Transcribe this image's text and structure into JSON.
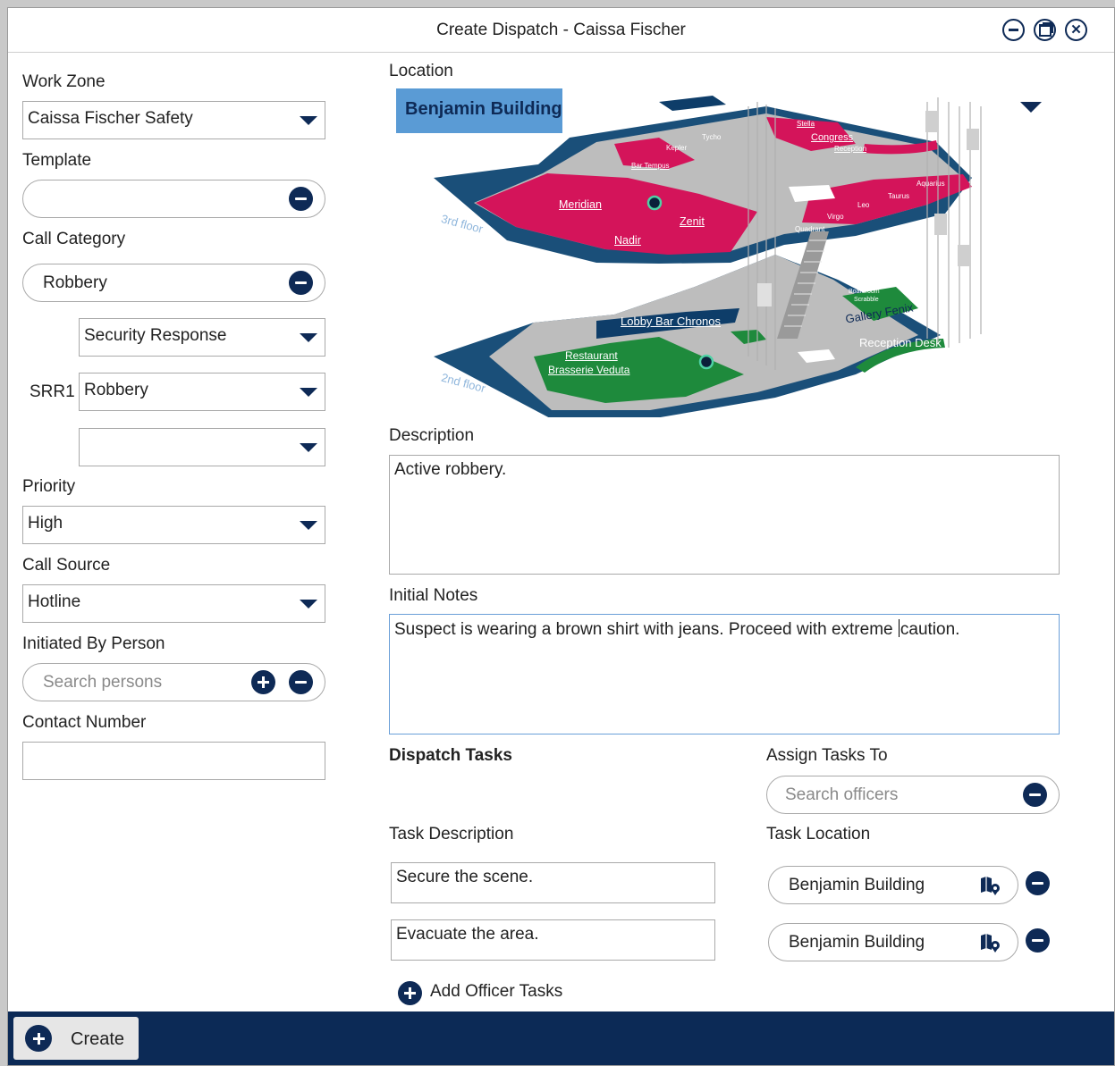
{
  "window": {
    "title": "Create Dispatch - Caissa Fischer"
  },
  "left": {
    "work_zone": {
      "label": "Work Zone",
      "value": "Caissa Fischer Safety"
    },
    "template": {
      "label": "Template",
      "value": ""
    },
    "call_category": {
      "label": "Call Category",
      "value": "Robbery"
    },
    "subcategory_1": {
      "value": "Security Response"
    },
    "subcategory_2": {
      "code": "SRR1",
      "value": "Robbery"
    },
    "subcategory_3": {
      "value": ""
    },
    "priority": {
      "label": "Priority",
      "value": "High"
    },
    "call_source": {
      "label": "Call Source",
      "value": "Hotline"
    },
    "initiated_by": {
      "label": "Initiated By Person",
      "placeholder": "Search persons"
    },
    "contact_number": {
      "label": "Contact Number",
      "value": ""
    }
  },
  "location": {
    "label": "Location",
    "building": "Benjamin Building",
    "floors": {
      "upper": "3rd floor",
      "lower": "2nd floor"
    },
    "rooms_upper": [
      "Meridian",
      "Zenit",
      "Nadir",
      "Kepler",
      "Tycho",
      "Bar Tempus",
      "Stella",
      "Congress",
      "Reception",
      "Aquarius",
      "Taurus",
      "Leo",
      "Virgo",
      "Quadrant"
    ],
    "rooms_lower": [
      "Lobby Bar Chronos",
      "Restaurant",
      "Brasserie Veduta",
      "Gallery Fenix",
      "Reception Desk",
      "Boardroom",
      "Scrabble"
    ]
  },
  "description": {
    "label": "Description",
    "value": "Active robbery."
  },
  "initial_notes": {
    "label": "Initial Notes",
    "value_before_caret": "Suspect is wearing a brown shirt with jeans. Proceed with extreme ",
    "value_after_caret": "caution."
  },
  "tasks": {
    "heading": "Dispatch Tasks",
    "assign_label": "Assign Tasks To",
    "assign_placeholder": "Search officers",
    "task_description_header": "Task Description",
    "task_location_header": "Task Location",
    "rows": [
      {
        "description": "Secure the scene.",
        "location": "Benjamin Building"
      },
      {
        "description": "Evacuate the area.",
        "location": "Benjamin Building"
      }
    ],
    "add_label": "Add Officer Tasks"
  },
  "footer": {
    "create_label": "Create"
  },
  "colors": {
    "navy": "#0e2a56",
    "magenta": "#d4145a",
    "green": "#1e8a3c",
    "floor_blue": "#1a4f79",
    "accent_blue": "#5a9bd5"
  }
}
